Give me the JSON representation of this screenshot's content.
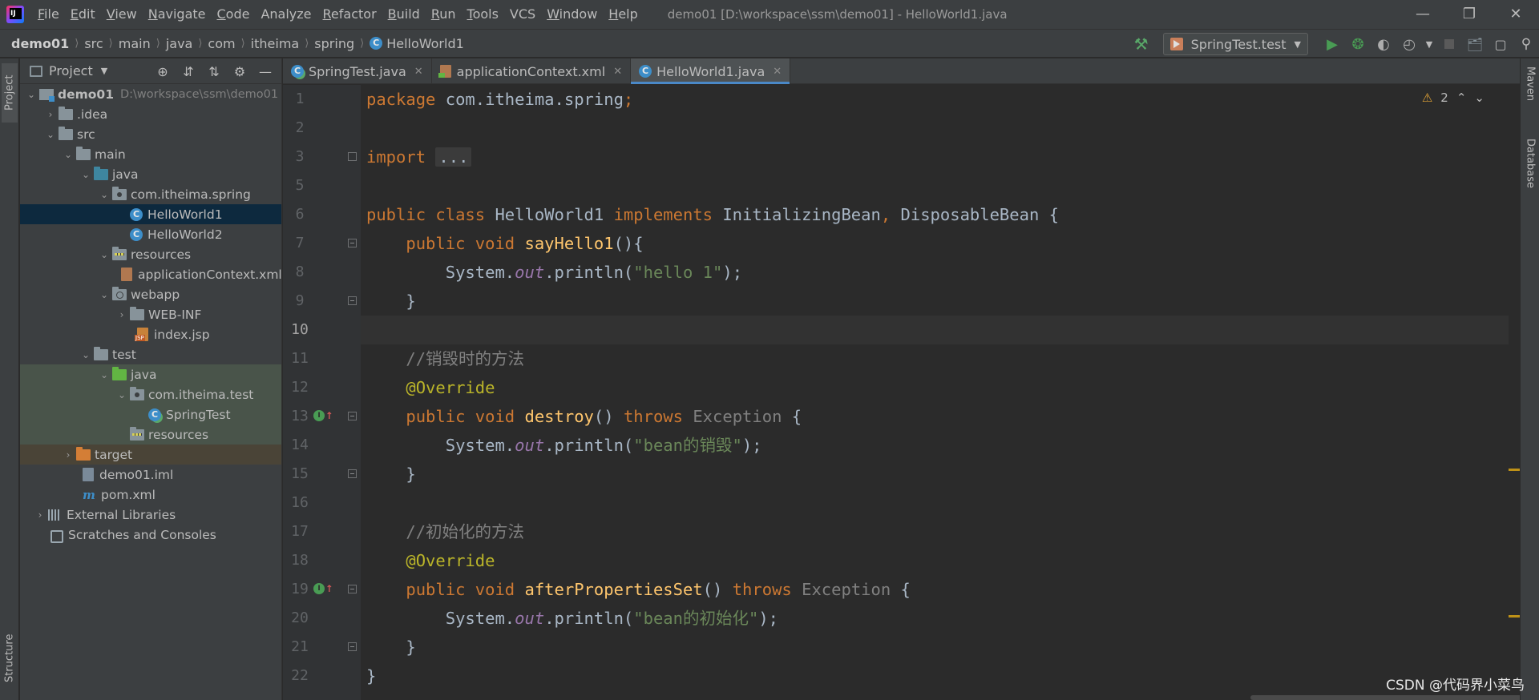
{
  "menubar": {
    "items": [
      {
        "label": "File",
        "mnemonic": "F",
        "rest": "ile"
      },
      {
        "label": "Edit",
        "mnemonic": "E",
        "rest": "dit"
      },
      {
        "label": "View",
        "mnemonic": "V",
        "rest": "iew"
      },
      {
        "label": "Navigate",
        "mnemonic": "N",
        "rest": "avigate"
      },
      {
        "label": "Code",
        "mnemonic": "C",
        "rest": "ode"
      },
      {
        "label": "Analyze",
        "mnemonic": "",
        "rest": "Analyze"
      },
      {
        "label": "Refactor",
        "mnemonic": "R",
        "rest": "efactor"
      },
      {
        "label": "Build",
        "mnemonic": "B",
        "rest": "uild"
      },
      {
        "label": "Run",
        "mnemonic": "R",
        "rest": "un"
      },
      {
        "label": "Tools",
        "mnemonic": "T",
        "rest": "ools"
      },
      {
        "label": "VCS",
        "mnemonic": "",
        "rest": "VCS"
      },
      {
        "label": "Window",
        "mnemonic": "W",
        "rest": "indow"
      },
      {
        "label": "Help",
        "mnemonic": "H",
        "rest": "elp"
      }
    ],
    "window_title": "demo01 [D:\\workspace\\ssm\\demo01] - HelloWorld1.java"
  },
  "navbar": {
    "breadcrumbs": [
      "demo01",
      "src",
      "main",
      "java",
      "com",
      "itheima",
      "spring",
      "HelloWorld1"
    ],
    "run_config": "SpringTest.test"
  },
  "tool_windows": {
    "project": "Project",
    "structure": "Structure",
    "maven": "Maven",
    "database": "Database"
  },
  "project_panel": {
    "title": "Project",
    "tree": [
      {
        "label": "demo01",
        "sub": "D:\\workspace\\ssm\\demo01"
      },
      {
        "label": ".idea"
      },
      {
        "label": "src"
      },
      {
        "label": "main"
      },
      {
        "label": "java"
      },
      {
        "label": "com.itheima.spring"
      },
      {
        "label": "HelloWorld1"
      },
      {
        "label": "HelloWorld2"
      },
      {
        "label": "resources"
      },
      {
        "label": "applicationContext.xml"
      },
      {
        "label": "webapp"
      },
      {
        "label": "WEB-INF"
      },
      {
        "label": "index.jsp"
      },
      {
        "label": "test"
      },
      {
        "label": "java"
      },
      {
        "label": "com.itheima.test"
      },
      {
        "label": "SpringTest"
      },
      {
        "label": "resources"
      },
      {
        "label": "target"
      },
      {
        "label": "demo01.iml"
      },
      {
        "label": "pom.xml"
      },
      {
        "label": "External Libraries"
      },
      {
        "label": "Scratches and Consoles"
      }
    ]
  },
  "editor_tabs": [
    {
      "label": "SpringTest.java"
    },
    {
      "label": "applicationContext.xml"
    },
    {
      "label": "HelloWorld1.java"
    }
  ],
  "editor": {
    "warning_count": "2",
    "line_numbers": [
      "1",
      "2",
      "3",
      "5",
      "6",
      "7",
      "8",
      "9",
      "10",
      "11",
      "12",
      "13",
      "14",
      "15",
      "16",
      "17",
      "18",
      "19",
      "20",
      "21",
      "22"
    ],
    "code": {
      "l1_kw": "package",
      "l1_rest": " com.itheima.spring",
      "l1_semi": ";",
      "l3_kw": "import",
      "l3_fold": "...",
      "l6_kw1": "public",
      "l6_kw2": "class",
      "l6_name": " HelloWorld1 ",
      "l6_kw3": "implements",
      "l6_iface1": " InitializingBean",
      "l6_comma": ",",
      "l6_iface2": " DisposableBean {",
      "l7_kw1": "public",
      "l7_kw2": "void",
      "l7_fn": "sayHello1",
      "l7_rest": "(){",
      "sys": "System.",
      "out": "out",
      "println": ".println(",
      "l8_str": "\"hello 1\"",
      "close_stmt": ");",
      "close_brace": "}",
      "l11_cmt": "//销毁时的方法",
      "override": "@Override",
      "l13_kw1": "public",
      "l13_kw2": "void",
      "l13_fn": "destroy",
      "l13_paren": "() ",
      "throws": "throws",
      "exception": " Exception",
      "open_brace": " {",
      "l14_str": "\"bean的销毁\"",
      "l17_cmt": "//初始化的方法",
      "l19_kw1": "public",
      "l19_kw2": "void",
      "l19_fn": "afterPropertiesSet",
      "l19_paren": "() ",
      "l20_str": "\"bean的初始化\"",
      "l22_brace": "}"
    }
  },
  "watermark": "CSDN @代码界小菜鸟",
  "colors": {
    "background": "#2b2b2b",
    "keyword": "#cc7832",
    "annotation": "#bbb529",
    "string": "#6a8759",
    "comment": "#808080",
    "method": "#ffc66d",
    "field": "#9876aa",
    "selection": "#0d293e"
  }
}
